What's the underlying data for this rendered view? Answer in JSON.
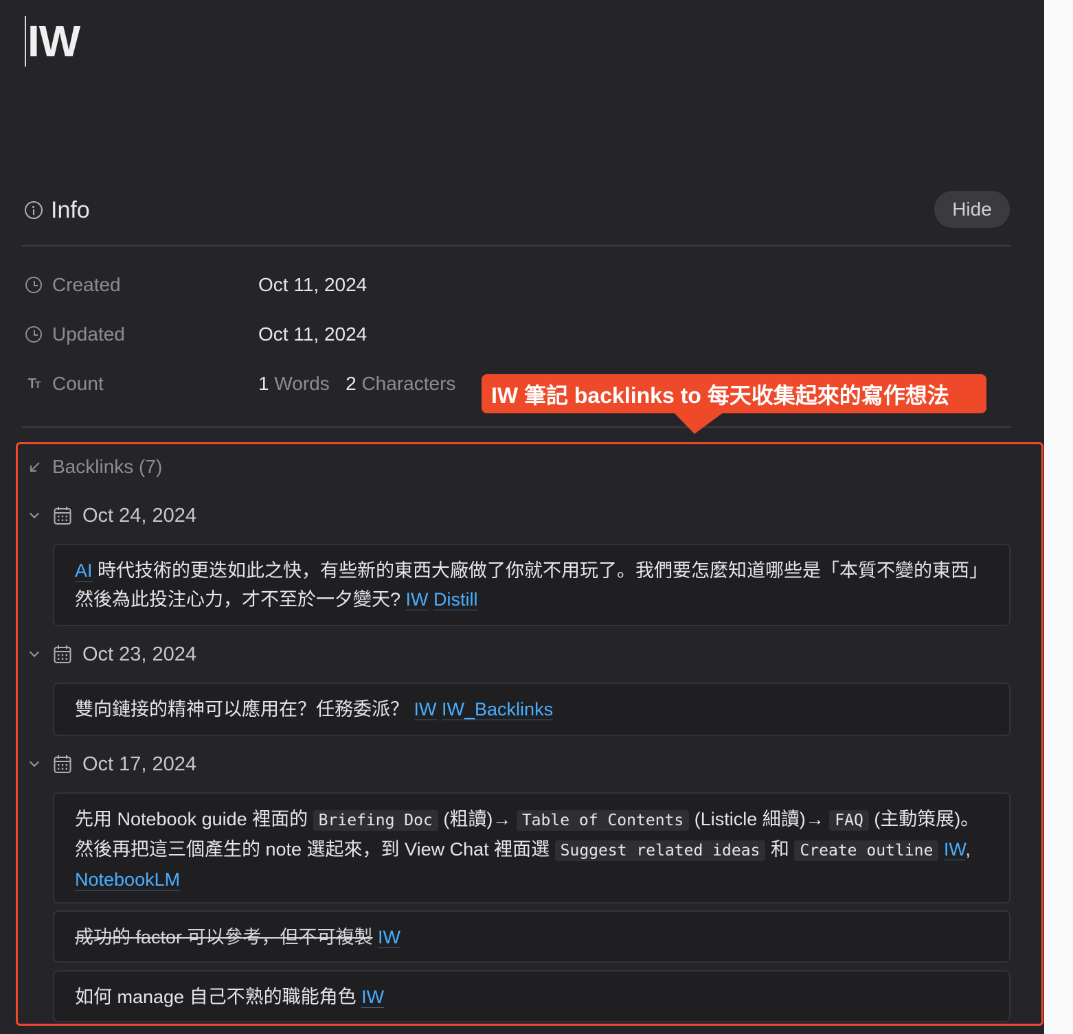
{
  "note": {
    "title": "IW"
  },
  "info": {
    "label": "Info",
    "hide_label": "Hide",
    "created_label": "Created",
    "created_value": "Oct 11, 2024",
    "updated_label": "Updated",
    "updated_value": "Oct 11, 2024",
    "count_label": "Count",
    "words_count": "1",
    "words_unit": "Words",
    "chars_count": "2",
    "chars_unit": "Characters"
  },
  "callout": {
    "text": "IW 筆記 backlinks to 每天收集起來的寫作想法",
    "color": "#ee4a2a"
  },
  "backlinks": {
    "label": "Backlinks (7)",
    "groups": [
      {
        "date": "Oct 24, 2024",
        "entries": [
          {
            "link_ai": "AI",
            "text": " 時代技術的更迭如此之快，有些新的東西大廠做了你就不用玩了。我們要怎麼知道哪些是「本質不變的東西」然後為此投注心力，才不至於一夕變天? ",
            "link_iw": "IW",
            "link_distill": "Distill"
          }
        ]
      },
      {
        "date": "Oct 23, 2024",
        "entries": [
          {
            "text": "雙向鏈接的精神可以應用在？任務委派？ ",
            "link_iw": "IW",
            "link_backlinks": "IW_Backlinks"
          }
        ]
      },
      {
        "date": "Oct 17, 2024",
        "entries": [
          {
            "t1": "先用 Notebook guide 裡面的 ",
            "c1": "Briefing Doc",
            "t2": " (粗讀)→ ",
            "c2": "Table of Contents",
            "t3": " (Listicle 細讀)→ ",
            "c3": "FAQ",
            "t4": " (主動策展)。然後再把這三個產生的 note 選起來，到 View Chat 裡面選 ",
            "c4": "Suggest related ideas",
            "t5": " 和 ",
            "c5": "Create outline",
            "t6": " ",
            "link_iw": "IW",
            "t7": ", ",
            "link_notebooklm": "NotebookLM"
          },
          {
            "strike_text": "成功的 factor 可以參考，但不可複製",
            "link_iw": "IW"
          },
          {
            "text": "如何 manage 自己不熟的職能角色 ",
            "link_iw": "IW"
          }
        ]
      }
    ]
  },
  "colors": {
    "background": "#252529",
    "card": "#1f1f22",
    "link": "#4aaeff",
    "accent": "#ee4a2a"
  }
}
